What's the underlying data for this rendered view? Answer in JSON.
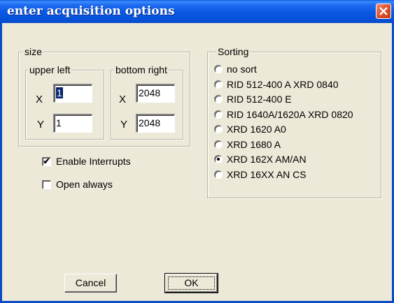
{
  "window": {
    "title": "enter acquisition options"
  },
  "size_group": {
    "label": "size",
    "upper_left": {
      "label": "upper left",
      "x_label": "X",
      "y_label": "Y",
      "x_value": "1",
      "y_value": "1"
    },
    "bottom_right": {
      "label": "bottom right",
      "x_label": "X",
      "y_label": "Y",
      "x_value": "2048",
      "y_value": "2048"
    }
  },
  "checkboxes": [
    {
      "label": "Enable Interrupts",
      "checked": true
    },
    {
      "label": "Open always",
      "checked": false
    }
  ],
  "sorting": {
    "label": "Sorting",
    "options": [
      {
        "label": "no sort",
        "selected": false
      },
      {
        "label": "RID 512-400 A XRD 0840",
        "selected": false
      },
      {
        "label": "RID 512-400 E",
        "selected": false
      },
      {
        "label": "RID 1640A/1620A XRD 0820",
        "selected": false
      },
      {
        "label": "XRD 1620 A0",
        "selected": false
      },
      {
        "label": "XRD 1680 A",
        "selected": false
      },
      {
        "label": "XRD 162X AM/AN",
        "selected": true
      },
      {
        "label": "XRD 16XX AN CS",
        "selected": false
      }
    ]
  },
  "buttons": {
    "cancel": "Cancel",
    "ok": "OK"
  },
  "colors": {
    "titlebar": "#0a58e2",
    "close": "#e0502c",
    "face": "#ece9d8"
  }
}
